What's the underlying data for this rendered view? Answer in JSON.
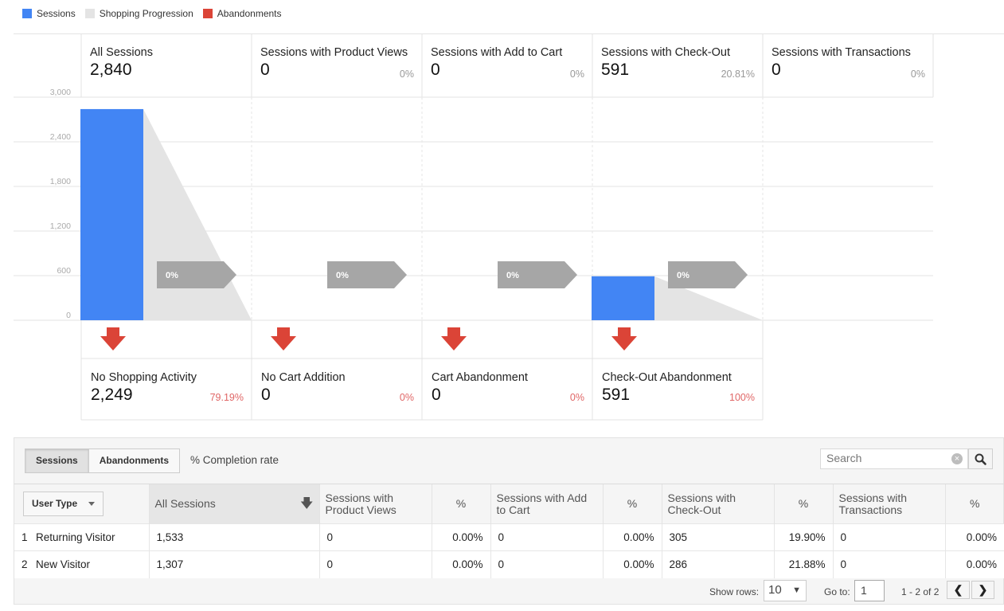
{
  "legend": [
    {
      "label": "Sessions",
      "color": "#4285f4"
    },
    {
      "label": "Shopping Progression",
      "color": "#e4e4e4"
    },
    {
      "label": "Abandonments",
      "color": "#db4437"
    }
  ],
  "chart_data": {
    "type": "bar",
    "categories": [
      "All Sessions",
      "Sessions with Product Views",
      "Sessions with Add to Cart",
      "Sessions with Check-Out",
      "Sessions with Transactions"
    ],
    "values": [
      2840,
      0,
      0,
      591,
      0
    ],
    "yticks": [
      "3,000",
      "2,400",
      "1,800",
      "1,200",
      "600",
      "0"
    ],
    "ylim": [
      0,
      3000
    ],
    "progression_labels": [
      "0%",
      "0%",
      "0%",
      "0%"
    ]
  },
  "stages": [
    {
      "title": "All Sessions",
      "value": "2,840",
      "pct": ""
    },
    {
      "title": "Sessions with Product Views",
      "value": "0",
      "pct": "0%"
    },
    {
      "title": "Sessions with Add to Cart",
      "value": "0",
      "pct": "0%"
    },
    {
      "title": "Sessions with Check-Out",
      "value": "591",
      "pct": "20.81%"
    },
    {
      "title": "Sessions with Transactions",
      "value": "0",
      "pct": "0%"
    }
  ],
  "abandonments": [
    {
      "title": "No Shopping Activity",
      "value": "2,249",
      "pct": "79.19%"
    },
    {
      "title": "No Cart Addition",
      "value": "0",
      "pct": "0%"
    },
    {
      "title": "Cart Abandonment",
      "value": "0",
      "pct": "0%"
    },
    {
      "title": "Check-Out Abandonment",
      "value": "591",
      "pct": "100%"
    }
  ],
  "controls": {
    "sessions_tab": "Sessions",
    "abandonments_tab": "Abandonments",
    "completion_rate": "% Completion rate",
    "search_placeholder": "Search"
  },
  "table": {
    "dimension_label": "User Type",
    "headers": [
      "All Sessions",
      "Sessions with Product Views",
      "%",
      "Sessions with Add to Cart",
      "%",
      "Sessions with Check-Out",
      "%",
      "Sessions with Transactions",
      "%"
    ],
    "rows": [
      {
        "rank": "1",
        "name": "Returning Visitor",
        "cells": [
          "1,533",
          "0",
          "0.00%",
          "0",
          "0.00%",
          "305",
          "19.90%",
          "0",
          "0.00%"
        ]
      },
      {
        "rank": "2",
        "name": "New Visitor",
        "cells": [
          "1,307",
          "0",
          "0.00%",
          "0",
          "0.00%",
          "286",
          "21.88%",
          "0",
          "0.00%"
        ]
      }
    ]
  },
  "footer": {
    "show_rows_label": "Show rows:",
    "rows_value": "10",
    "goto_label": "Go to:",
    "goto_value": "1",
    "range": "1 - 2 of 2"
  }
}
